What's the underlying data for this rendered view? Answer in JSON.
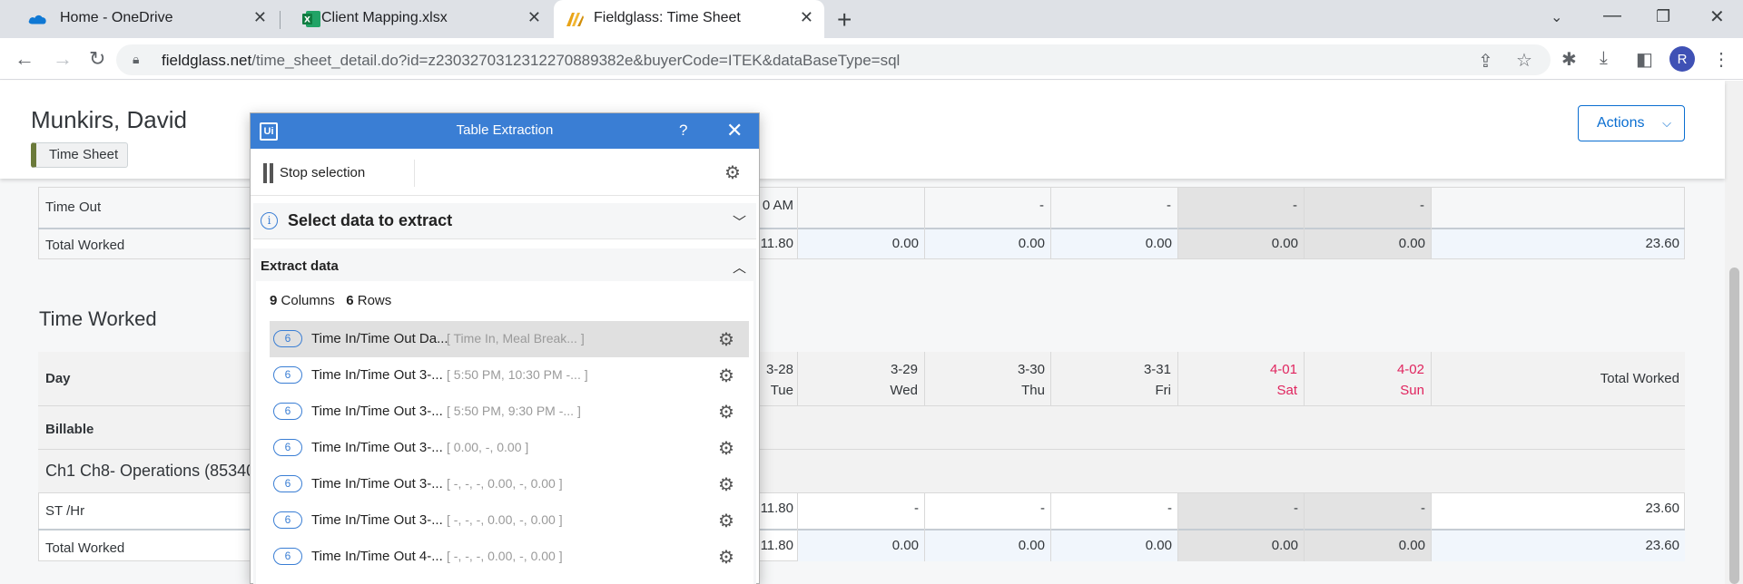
{
  "browser": {
    "tabs": [
      {
        "title": "Home - OneDrive",
        "icon": "onedrive-icon"
      },
      {
        "title": "Client Mapping.xlsx",
        "icon": "excel-icon"
      },
      {
        "title": "Fieldglass: Time Sheet",
        "icon": "fieldglass-icon"
      }
    ],
    "url_host": "fieldglass.net",
    "url_path": "/time_sheet_detail.do?id=z230327031231227088938​2e&buyerCode=ITEK&dataBaseType=sql",
    "avatar_letter": "R"
  },
  "header": {
    "worker_name": "Munkirs, David",
    "badge": "Time Sheet",
    "actions_label": "Actions"
  },
  "summary_rows": {
    "time_out": {
      "label": "Time Out",
      "partial": "0 AM",
      "cells": [
        "",
        "-",
        "-",
        "-",
        "-",
        ""
      ]
    },
    "total_worked": {
      "label": "Total Worked",
      "partial": "11.80",
      "cells": [
        "0.00",
        "0.00",
        "0.00",
        "0.00",
        "0.00",
        "23.60"
      ]
    }
  },
  "time_worked": {
    "title": "Time Worked",
    "day_label": "Day",
    "days": [
      {
        "date": "3-28",
        "dow": "Tue",
        "weekend": false
      },
      {
        "date": "3-29",
        "dow": "Wed",
        "weekend": false
      },
      {
        "date": "3-30",
        "dow": "Thu",
        "weekend": false
      },
      {
        "date": "3-31",
        "dow": "Fri",
        "weekend": false
      },
      {
        "date": "4-01",
        "dow": "Sat",
        "weekend": true
      },
      {
        "date": "4-02",
        "dow": "Sun",
        "weekend": true
      }
    ],
    "total_header": "Total Worked",
    "billable_label": "Billable",
    "operations_label": "Ch1 Ch8- Operations (85340",
    "st_row": {
      "label": "ST /Hr",
      "partial": "11.80",
      "cells": [
        "-",
        "-",
        "-",
        "-",
        "-",
        "23.60"
      ]
    },
    "total_row": {
      "label": "Total Worked",
      "partial": "11.80",
      "cells": [
        "0.00",
        "0.00",
        "0.00",
        "0.00",
        "0.00",
        "23.60"
      ]
    }
  },
  "dialog": {
    "title": "Table Extraction",
    "help": "?",
    "stop_selection": "Stop selection",
    "select_data": "Select data to extract",
    "extract_data": "Extract data",
    "columns_count": "9",
    "columns_label": "Columns",
    "rows_count": "6",
    "rows_label": "Rows",
    "columns": [
      {
        "count": "6",
        "name": "Time In/Time Out Da...",
        "preview": "[ Time In, Meal Break...   ]"
      },
      {
        "count": "6",
        "name": "Time In/Time Out 3-...",
        "preview": "[ 5:50 PM, 10:30 PM -...   ]"
      },
      {
        "count": "6",
        "name": "Time In/Time Out 3-...",
        "preview": "[ 5:50 PM, 9:30 PM -...    ]"
      },
      {
        "count": "6",
        "name": "Time In/Time Out 3-...",
        "preview": "[ 0.00, -, 0.00            ]"
      },
      {
        "count": "6",
        "name": "Time In/Time Out 3-...",
        "preview": "[ -, -, -, 0.00, -, 0.00   ]"
      },
      {
        "count": "6",
        "name": "Time In/Time Out 3-...",
        "preview": "[ -, -, -, 0.00, -, 0.00   ]"
      },
      {
        "count": "6",
        "name": "Time In/Time Out 4-...",
        "preview": "[ -, -, -, 0.00, -, 0.00   ]"
      }
    ]
  },
  "colors": {
    "accent": "#3a7ed4",
    "actions_blue": "#0a6ed1",
    "weekend_pink": "#e0245e",
    "weekend_shade": "#e3e3e3"
  }
}
